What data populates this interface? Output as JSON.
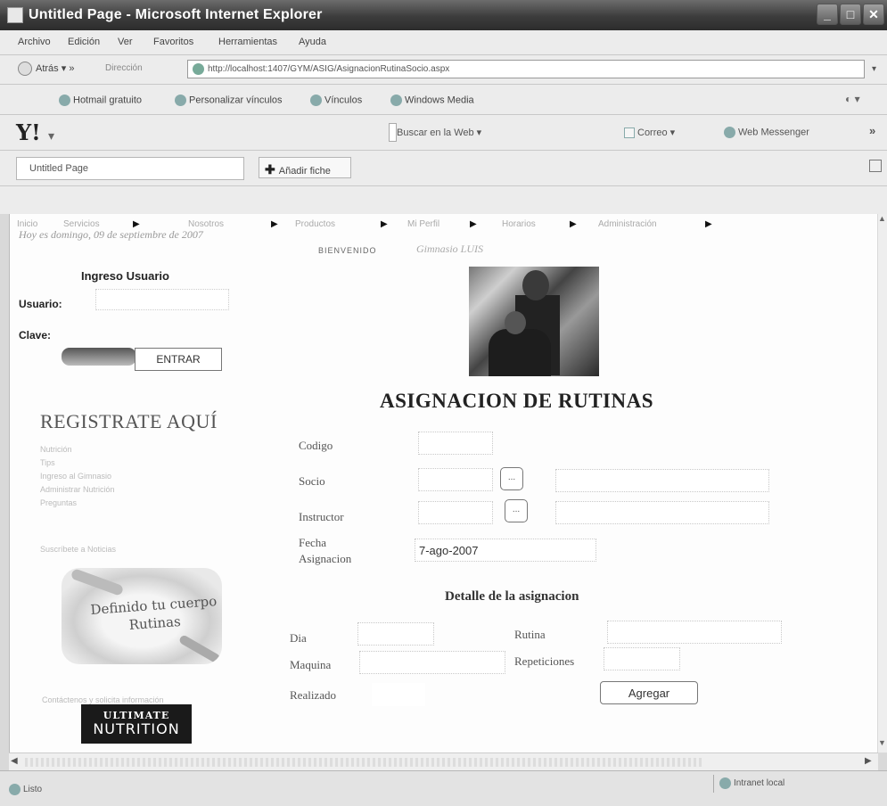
{
  "window": {
    "title": "Untitled Page - Microsoft Internet Explorer",
    "buttons": [
      "_",
      "□",
      "✕"
    ]
  },
  "menu": [
    "Archivo",
    "Edición",
    "Ver",
    "Favoritos",
    "Herramientas",
    "Ayuda"
  ],
  "nav": {
    "back_label": "Atrás",
    "address_label": "Dirección",
    "url": "http://localhost:1407/GYM/ASIG/AsignacionRutinaSocio.aspx",
    "go_arrow": "▾"
  },
  "favorites": [
    "Hotmail gratuito",
    "Personalizar vínculos",
    "Vínculos",
    "Windows Media"
  ],
  "yahoo": {
    "logo": "Y!",
    "search": "Buscar en la Web",
    "mail": "Correo",
    "messenger": "Web Messenger",
    "more": "»"
  },
  "tabs": {
    "active": "Untitled Page",
    "add_favorite": "Añadir fiche"
  },
  "site_nav": [
    "Inicio",
    "Servicios",
    "Nosotros",
    "Productos",
    "Mi Perfil",
    "Horarios",
    "Administración"
  ],
  "header": {
    "date": "Hoy es domingo, 09 de septiembre de 2007",
    "welcome": "BIENVENIDO",
    "gym": "Gimnasio LUIS"
  },
  "login": {
    "title": "Ingreso Usuario",
    "user_label": "Usuario:",
    "pass_label": "Clave:",
    "submit": "ENTRAR"
  },
  "sidebar": {
    "register": "REGISTRATE AQUÍ",
    "links": [
      "Nutrición",
      "Tips",
      "Ingreso al Gimnasio",
      "Administrar Nutrición",
      "Preguntas"
    ],
    "newsletter": "Suscríbete a Noticias",
    "promo_text": "Definido tu cuerpo Rutinas",
    "footer_text": "Contáctenos y solicita información",
    "brand_top": "ULTIMATE",
    "brand_bottom": "NUTRITION"
  },
  "form": {
    "title": "ASIGNACION DE RUTINAS",
    "codigo_label": "Codigo",
    "socio_label": "Socio",
    "instructor_label": "Instructor",
    "fecha_label_1": "Fecha",
    "fecha_label_2": "Asignacion",
    "fecha_value": "7-ago-2007",
    "lookup_button": "..."
  },
  "detail": {
    "title": "Detalle de la asignacion",
    "dia_label": "Dia",
    "rutina_label": "Rutina",
    "maquina_label": "Maquina",
    "repeticiones_label": "Repeticiones",
    "realizado_label": "Realizado",
    "add_button": "Agregar"
  },
  "status": {
    "text": "Listo",
    "zone": "Intranet local"
  }
}
